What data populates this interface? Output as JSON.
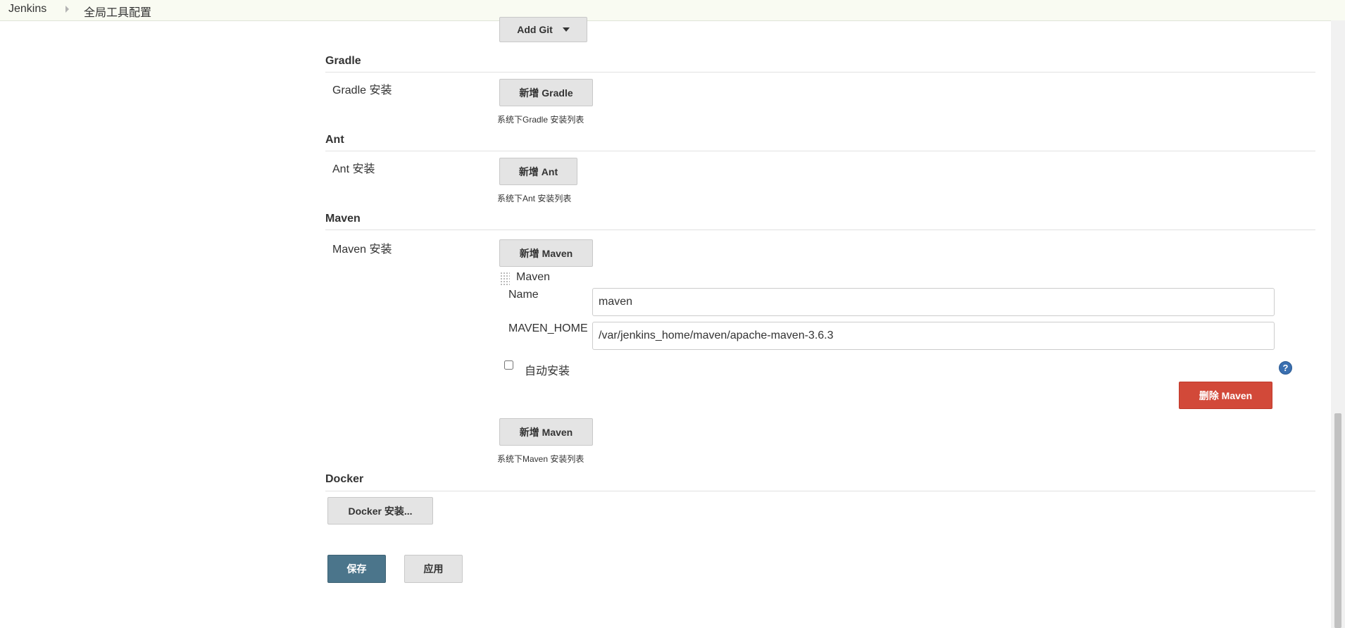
{
  "breadcrumb": {
    "home": "Jenkins",
    "current": "全局工具配置"
  },
  "git": {
    "add_button": "Add Git"
  },
  "gradle": {
    "title": "Gradle",
    "install_label": "Gradle 安装",
    "add_button": "新增 Gradle",
    "hint": "系统下Gradle 安装列表"
  },
  "ant": {
    "title": "Ant",
    "install_label": "Ant 安装",
    "add_button": "新增 Ant",
    "hint": "系统下Ant 安装列表"
  },
  "maven": {
    "title": "Maven",
    "install_label": "Maven 安装",
    "add_button_top": "新增 Maven",
    "block_title": "Maven",
    "name_label": "Name",
    "name_value": "maven",
    "home_label": "MAVEN_HOME",
    "home_value": "/var/jenkins_home/maven/apache-maven-3.6.3",
    "auto_install_label": "自动安装",
    "delete_button": "删除 Maven",
    "add_button_bottom": "新增 Maven",
    "hint": "系统下Maven 安装列表"
  },
  "docker": {
    "title": "Docker",
    "install_button": "Docker 安装..."
  },
  "actions": {
    "save": "保存",
    "apply": "应用"
  },
  "help_icon": {
    "glyph": "?"
  },
  "colors": {
    "primary": "#4b758b",
    "danger": "#d24939",
    "help": "#3a6fb0",
    "breadcrumb_bg": "#f9fbf2"
  }
}
